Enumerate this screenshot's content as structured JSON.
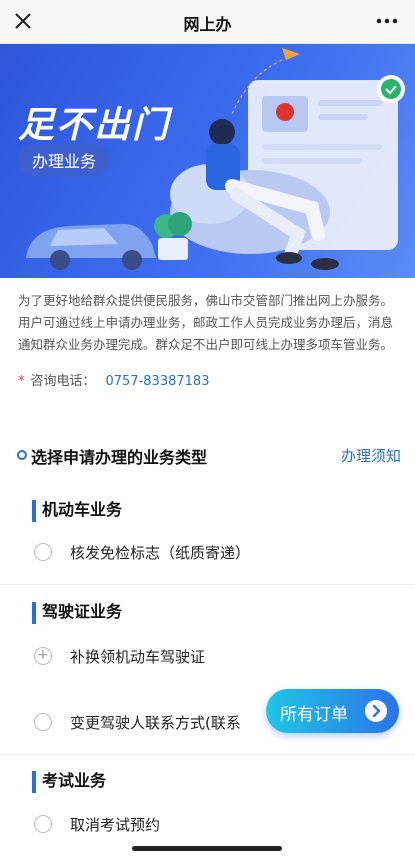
{
  "topbar": {
    "title": "网上办",
    "close_icon": "close-icon",
    "more_icon": "more-icon"
  },
  "banner": {
    "headline": "足不出门",
    "tag": "办理业务"
  },
  "intro": {
    "text": "为了更好地给群众提供便民服务，佛山市交管部门推出网上办服务。用户可通过线上申请办理业务，邮政工作人员完成业务办理后，消息通知群众业务办理完成。群众足不出户即可线上办理多项车管业务。",
    "phone_mark": "*",
    "phone_label": "咨询电话：",
    "phone_number": "0757-83387183"
  },
  "section": {
    "title": "选择申请办理的业务类型",
    "guide_link": "办理须知"
  },
  "categories": [
    {
      "name": "机动车业务",
      "items": [
        {
          "label": "核发免检标志（纸质寄递）"
        }
      ]
    },
    {
      "name": "驾驶证业务",
      "items": [
        {
          "label": "补换领机动车驾驶证"
        },
        {
          "label": "变更驾驶人联系方式(联系"
        }
      ]
    },
    {
      "name": "考试业务",
      "items": [
        {
          "label": "取消考试预约"
        }
      ]
    }
  ],
  "floating": {
    "orders_label": "所有订单"
  },
  "colors": {
    "accent": "#2b6fd6",
    "banner": "#3c6ef0",
    "button_start": "#1fc6e6",
    "button_end": "#2b74e8"
  }
}
